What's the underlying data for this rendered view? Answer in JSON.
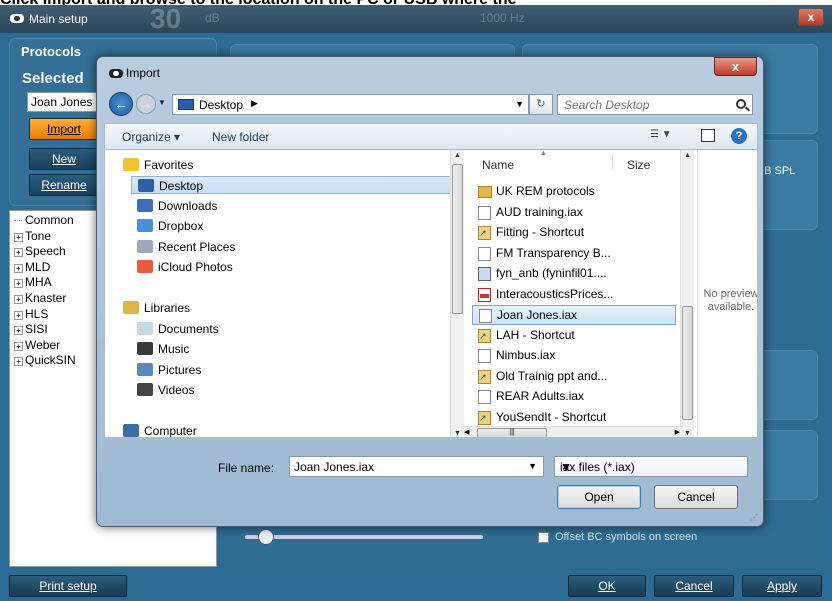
{
  "instruction": "Click Import and browse to the location on the PC or USB where the",
  "main_window": {
    "title": "Main setup",
    "bg_title_number": "30",
    "bg_title_unit": "dB",
    "bg_title_freq": "1000 Hz",
    "close_label": "x",
    "protocols_title": "Protocols",
    "selected_label": "Selected",
    "selected_value": "Joan Jones",
    "import_label": "Import",
    "new_label": "New",
    "rename_label": "Rename",
    "tree": [
      {
        "label": "Common",
        "expandable": false
      },
      {
        "label": "Tone",
        "expandable": true
      },
      {
        "label": "Speech",
        "expandable": true
      },
      {
        "label": "MLD",
        "expandable": true
      },
      {
        "label": "MHA",
        "expandable": true
      },
      {
        "label": "Knaster",
        "expandable": true
      },
      {
        "label": "HLS",
        "expandable": true
      },
      {
        "label": "SISI",
        "expandable": true
      },
      {
        "label": "Weber",
        "expandable": true
      },
      {
        "label": "QuickSIN",
        "expandable": true
      }
    ],
    "bg_dbspl": "dB SPL",
    "offset_label": "Offset BC symbols on screen",
    "print_setup_label": "Print setup",
    "ok_label": "OK",
    "cancel_label": "Cancel",
    "apply_label": "Apply"
  },
  "dialog": {
    "title": "Import",
    "close_label": "x",
    "address": "Desktop",
    "search_placeholder": "Search Desktop",
    "organize_label": "Organize ▾",
    "new_folder_label": "New folder",
    "nav": [
      {
        "label": "Favorites",
        "group": true,
        "icon": "star-icon",
        "color": "#f2c12e"
      },
      {
        "label": "Desktop",
        "selected": true,
        "icon": "desktop-icon",
        "color": "#2b5fa8"
      },
      {
        "label": "Downloads",
        "icon": "downloads-icon",
        "color": "#3d6db5"
      },
      {
        "label": "Dropbox",
        "icon": "dropbox-icon",
        "color": "#4a90d9"
      },
      {
        "label": "Recent Places",
        "icon": "recent-places-icon",
        "color": "#9aa9b8"
      },
      {
        "label": "iCloud Photos",
        "icon": "icloud-photos-icon",
        "color": "#e85d3a"
      },
      {
        "label": "Libraries",
        "group": true,
        "icon": "libraries-icon",
        "color": "#e0b34a"
      },
      {
        "label": "Documents",
        "icon": "documents-icon",
        "color": "#c9d6e3"
      },
      {
        "label": "Music",
        "icon": "music-icon",
        "color": "#3a3a3a"
      },
      {
        "label": "Pictures",
        "icon": "pictures-icon",
        "color": "#5d8ab8"
      },
      {
        "label": "Videos",
        "icon": "videos-icon",
        "color": "#444444"
      },
      {
        "label": "Computer",
        "group": true,
        "icon": "computer-icon",
        "color": "#3b6ea5"
      }
    ],
    "columns": {
      "name": "Name",
      "size": "Size"
    },
    "files": [
      {
        "name": "UK REM protocols",
        "type": "folder"
      },
      {
        "name": "AUD training.iax",
        "type": "file"
      },
      {
        "name": "Fitting - Shortcut",
        "type": "shortcut"
      },
      {
        "name": "FM Transparency B...",
        "type": "file"
      },
      {
        "name": "fyn_anb (fyninfil01....",
        "type": "image"
      },
      {
        "name": "InteracousticsPrices...",
        "type": "pdf"
      },
      {
        "name": "Joan Jones.iax",
        "type": "file",
        "selected": true
      },
      {
        "name": "LAH - Shortcut",
        "type": "shortcut"
      },
      {
        "name": "Nimbus.iax",
        "type": "file"
      },
      {
        "name": "Old Trainig ppt and...",
        "type": "shortcut"
      },
      {
        "name": "REAR Adults.iax",
        "type": "file"
      },
      {
        "name": "YouSendIt - Shortcut",
        "type": "shortcut"
      }
    ],
    "preview_text": "No preview available.",
    "file_name_label": "File name:",
    "file_name_value": "Joan Jones.iax",
    "file_type": "iax files (*.iax)",
    "open_label": "Open",
    "cancel_label": "Cancel"
  }
}
